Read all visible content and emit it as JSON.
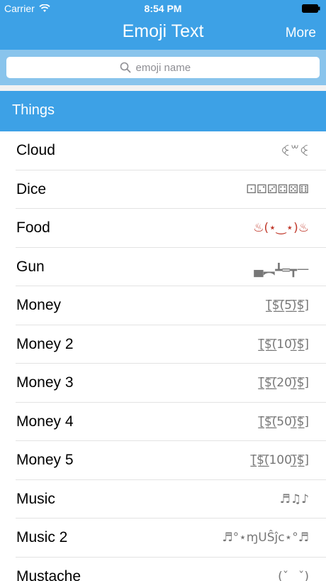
{
  "status": {
    "carrier": "Carrier",
    "time": "8:54 PM"
  },
  "nav": {
    "title": "Emoji Text",
    "more_label": "More"
  },
  "search": {
    "placeholder": "emoji name"
  },
  "section": {
    "title": "Things"
  },
  "rows": [
    {
      "label": "Cloud",
      "emoji": "ꒊ꒳ꒊ"
    },
    {
      "label": "Dice",
      "emoji": "⚀⚁⚂⚃⚄⚅"
    },
    {
      "label": "Food",
      "emoji": "♨(⋆‿⋆)♨"
    },
    {
      "label": "Gun",
      "emoji": "▄︻┻═┳一"
    },
    {
      "label": "Money",
      "emoji": "[̲̅$̲̅(̲̅5̲̅)̲̅$̲̅]"
    },
    {
      "label": "Money 2",
      "emoji": "[̲̅$̲̅(̲̅10)̲̅$̲̅]"
    },
    {
      "label": "Money 3",
      "emoji": "[̲̅$̲̅(̲̅20)̲̅$̲̅]"
    },
    {
      "label": "Money 4",
      "emoji": "[̲̅$̲̅(̲̅50)̲̅$̲̅]"
    },
    {
      "label": "Money 5",
      "emoji": "[̲̅$̲̅(̲̅100)̲̅$̲̅]"
    },
    {
      "label": "Music",
      "emoji": "♬♫♪"
    },
    {
      "label": "Music 2",
      "emoji": "♬°⋆ɱUŜĵc⋆°♬"
    },
    {
      "label": "Mustache",
      "emoji": "(ˇ‿ˇ)"
    }
  ],
  "colors": {
    "nav_blue": "#3da1e6",
    "search_bar": "#89c4ec"
  },
  "icons": {
    "status_wifi": "wifi-icon",
    "status_battery": "battery-icon",
    "search": "search-icon"
  }
}
